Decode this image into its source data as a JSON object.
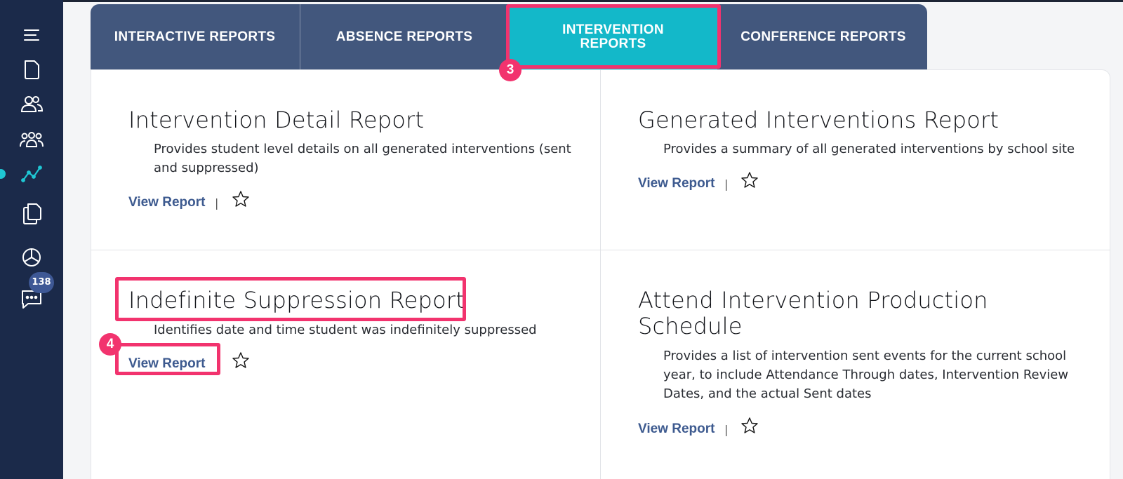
{
  "sidebar": {
    "icons": [
      "menu-icon",
      "document-icon",
      "users-icon",
      "groups-icon",
      "analytics-icon",
      "copy-icon",
      "pie-chart-icon",
      "chat-icon"
    ],
    "chat_badge": "138"
  },
  "tabs": [
    {
      "label": "INTERACTIVE REPORTS"
    },
    {
      "label": "ABSENCE REPORTS"
    },
    {
      "label": "INTERVENTION REPORTS",
      "active": true
    },
    {
      "label": "CONFERENCE REPORTS"
    }
  ],
  "cards": [
    {
      "title": "Intervention Detail Report",
      "description": "Provides student level details on all generated interventions (sent and suppressed)",
      "link": "View Report",
      "separator": "|"
    },
    {
      "title": "Generated Interventions Report",
      "description": "Provides a summary of all generated interventions by school site",
      "link": "View Report",
      "separator": "|"
    },
    {
      "title": "Indefinite Suppression Report",
      "description": "Identifies date and time student was indefinitely suppressed",
      "link": "View Report"
    },
    {
      "title": "Attend Intervention Production Schedule",
      "description": "Provides a list of intervention sent events for the current school year, to include Attendance Through dates, Intervention Review Dates, and the actual Sent dates",
      "link": "View Report",
      "separator": "|"
    }
  ],
  "annotations": {
    "step_3": "3",
    "step_4": "4",
    "color": "#f2336e"
  },
  "colors": {
    "sidebar": "#1b2a4a",
    "tab_bar": "#42577d",
    "active_tab": "#13b8c9",
    "link": "#3d5a8f"
  }
}
